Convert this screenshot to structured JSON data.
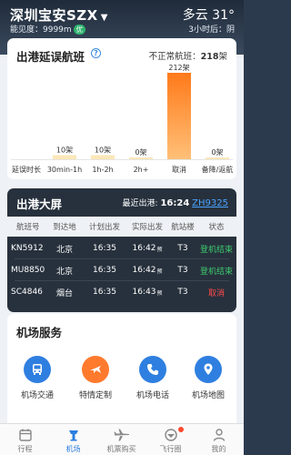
{
  "header": {
    "airport": "深圳宝安SZX",
    "visibility_label": "能见度：9999m",
    "visibility_badge": "优",
    "weather_now": "多云 31°",
    "weather_later": "3小时后：阴"
  },
  "delay_card": {
    "title": "出港延误航班",
    "abnormal_label": "不正常航班：",
    "abnormal_count": "218",
    "abnormal_unit": "架"
  },
  "chart_data": {
    "type": "bar",
    "categories": [
      "延误时长",
      "30min-1h",
      "1h-2h",
      "2h+",
      "取消",
      "备降/返航"
    ],
    "values": [
      null,
      10,
      10,
      0,
      212,
      0
    ],
    "data_labels": [
      "",
      "10架",
      "10架",
      "0架",
      "212架",
      "0架"
    ],
    "colors": {
      "normal": "#fbe7b8",
      "highlight": "#ff7a1a",
      "highlight_top": "#ffc078"
    },
    "ylim": [
      0,
      212
    ]
  },
  "departures": {
    "title": "出港大屏",
    "latest_label": "最近出港:",
    "latest_time": "16:24",
    "latest_flight": "ZH9325",
    "columns": [
      "航班号",
      "到达地",
      "计划出发",
      "实际出发",
      "航站楼",
      "状态"
    ],
    "rows": [
      {
        "flight": "KN5912",
        "dest": "北京",
        "planned": "16:35",
        "actual": "16:42",
        "actual_sup": "预",
        "terminal": "T3",
        "status": "登机结束",
        "status_type": "done"
      },
      {
        "flight": "MU8850",
        "dest": "北京",
        "planned": "16:35",
        "actual": "16:42",
        "actual_sup": "预",
        "terminal": "T3",
        "status": "登机结束",
        "status_type": "done"
      },
      {
        "flight": "SC4846",
        "dest": "烟台",
        "planned": "16:35",
        "actual": "16:43",
        "actual_sup": "预",
        "terminal": "T3",
        "status": "取消",
        "status_type": "cancel"
      }
    ]
  },
  "services": {
    "title": "机场服务",
    "items": [
      {
        "label": "机场交通",
        "icon": "bus-icon",
        "color": "#2f7fe0"
      },
      {
        "label": "特情定制",
        "icon": "plane-custom-icon",
        "color": "#ff7a2d"
      },
      {
        "label": "机场电话",
        "icon": "phone-icon",
        "color": "#2f7fe0"
      },
      {
        "label": "机场地图",
        "icon": "map-pin-icon",
        "color": "#2f7fe0"
      }
    ]
  },
  "nav": {
    "items": [
      {
        "label": "行程",
        "icon": "calendar-icon"
      },
      {
        "label": "机场",
        "icon": "control-tower-icon",
        "active": true
      },
      {
        "label": "机票购买",
        "icon": "airplane-icon"
      },
      {
        "label": "飞行圈",
        "icon": "community-icon"
      },
      {
        "label": "我的",
        "icon": "user-icon"
      }
    ]
  }
}
